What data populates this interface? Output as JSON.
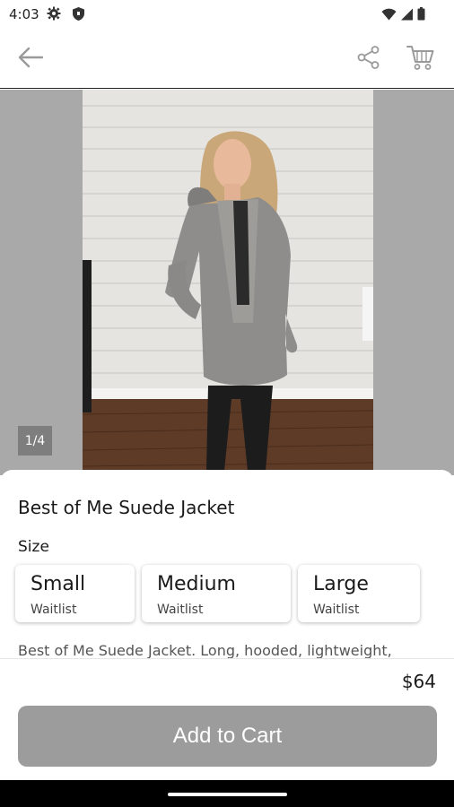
{
  "status_bar": {
    "time": "4:03",
    "left_icons": [
      "gear-icon",
      "shield-icon"
    ],
    "right_icons": [
      "wifi-icon",
      "signal-icon",
      "battery-icon"
    ]
  },
  "app_bar": {
    "icons": [
      "back-arrow-icon",
      "share-icon",
      "cart-icon"
    ]
  },
  "gallery": {
    "page_indicator": "1/4",
    "image": "woman-in-gray-hooded-jacket"
  },
  "product": {
    "title": "Best of Me Suede Jacket",
    "size_label": "Size",
    "sizes": [
      {
        "name": "Small",
        "status": "Waitlist"
      },
      {
        "name": "Medium",
        "status": "Waitlist"
      },
      {
        "name": "Large",
        "status": "Waitlist"
      }
    ],
    "description": "Best of Me Suede Jacket. Long, hooded, lightweight,",
    "price": "$64",
    "add_to_cart_label": "Add to Cart"
  },
  "colors": {
    "button_gray": "#9c9c9c",
    "gallery_bg": "#a9a9a9",
    "page_indicator_bg": "#7e7e7e"
  }
}
